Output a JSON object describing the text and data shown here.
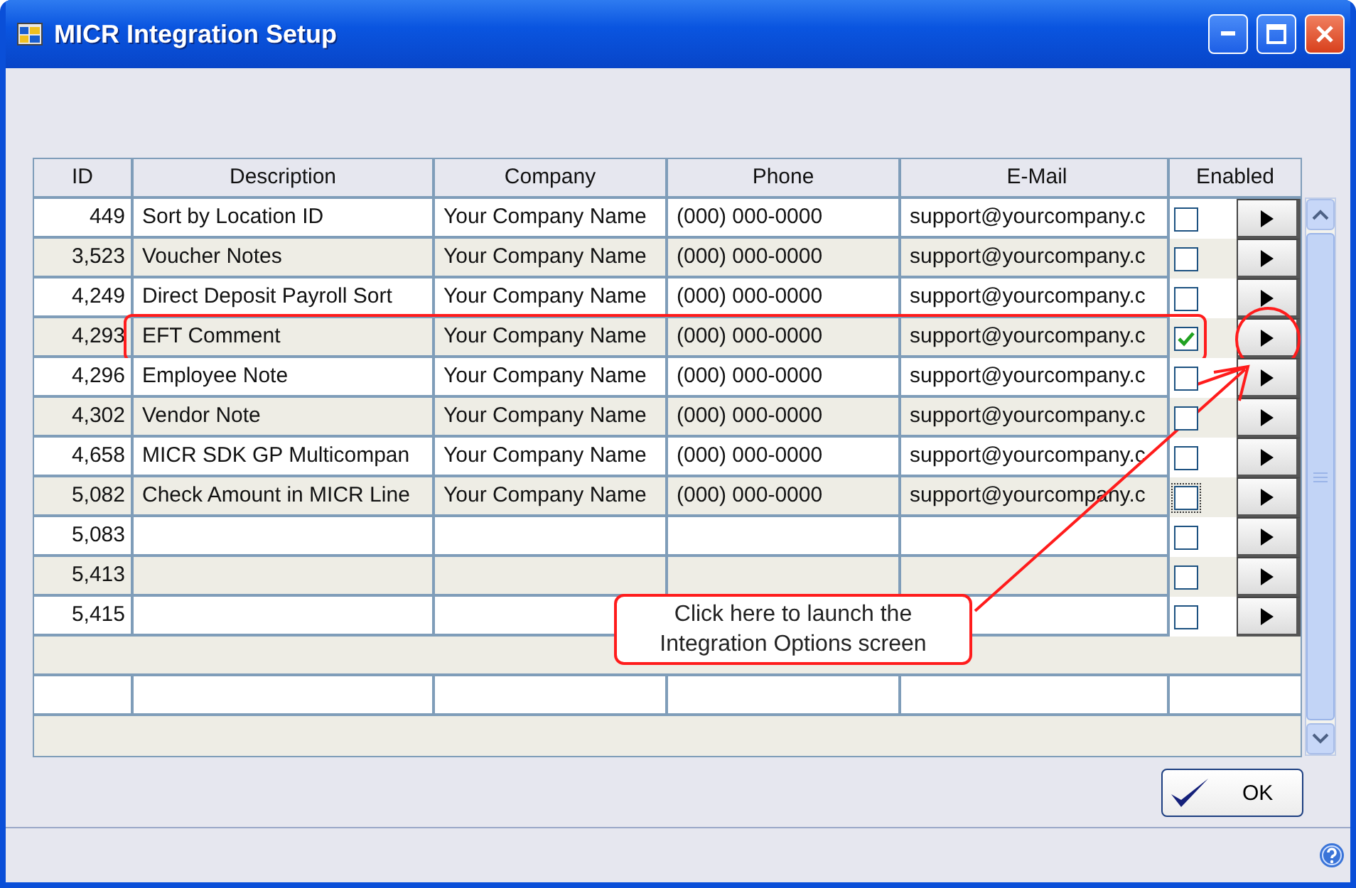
{
  "window": {
    "title": "MICR Integration Setup"
  },
  "table": {
    "columns": [
      "ID",
      "Description",
      "Company",
      "Phone",
      "E-Mail",
      "Enabled"
    ],
    "rows": [
      {
        "id": "449",
        "description": "Sort by Location ID",
        "company": "Your Company Name",
        "phone": "(000) 000-0000",
        "email": "support@yourcompany.c",
        "enabled": false,
        "focused": false,
        "highlighted": false
      },
      {
        "id": "3,523",
        "description": "Voucher Notes",
        "company": "Your Company Name",
        "phone": "(000) 000-0000",
        "email": "support@yourcompany.c",
        "enabled": false,
        "focused": false,
        "highlighted": false
      },
      {
        "id": "4,249",
        "description": "Direct Deposit Payroll Sort",
        "company": "Your Company Name",
        "phone": "(000) 000-0000",
        "email": "support@yourcompany.c",
        "enabled": false,
        "focused": false,
        "highlighted": false
      },
      {
        "id": "4,293",
        "description": "EFT Comment",
        "company": "Your Company Name",
        "phone": "(000) 000-0000",
        "email": "support@yourcompany.c",
        "enabled": true,
        "focused": false,
        "highlighted": true
      },
      {
        "id": "4,296",
        "description": "Employee Note",
        "company": "Your Company Name",
        "phone": "(000) 000-0000",
        "email": "support@yourcompany.c",
        "enabled": false,
        "focused": false,
        "highlighted": false
      },
      {
        "id": "4,302",
        "description": "Vendor Note",
        "company": "Your Company Name",
        "phone": "(000) 000-0000",
        "email": "support@yourcompany.c",
        "enabled": false,
        "focused": false,
        "highlighted": false
      },
      {
        "id": "4,658",
        "description": "MICR SDK GP Multicompan",
        "company": "Your Company Name",
        "phone": "(000) 000-0000",
        "email": "support@yourcompany.c",
        "enabled": false,
        "focused": false,
        "highlighted": false
      },
      {
        "id": "5,082",
        "description": "Check Amount in MICR Line",
        "company": "Your Company Name",
        "phone": "(000) 000-0000",
        "email": "support@yourcompany.c",
        "enabled": false,
        "focused": true,
        "highlighted": false
      },
      {
        "id": "5,083",
        "enabled": false,
        "focused": false,
        "highlighted": false
      },
      {
        "id": "5,413",
        "enabled": false,
        "focused": false,
        "highlighted": false
      },
      {
        "id": "5,415",
        "enabled": false,
        "focused": false,
        "highlighted": false
      }
    ]
  },
  "annotation": {
    "text": "Click here to launch the\nIntegration Options screen"
  },
  "buttons": [
    {
      "label": "OK"
    }
  ]
}
